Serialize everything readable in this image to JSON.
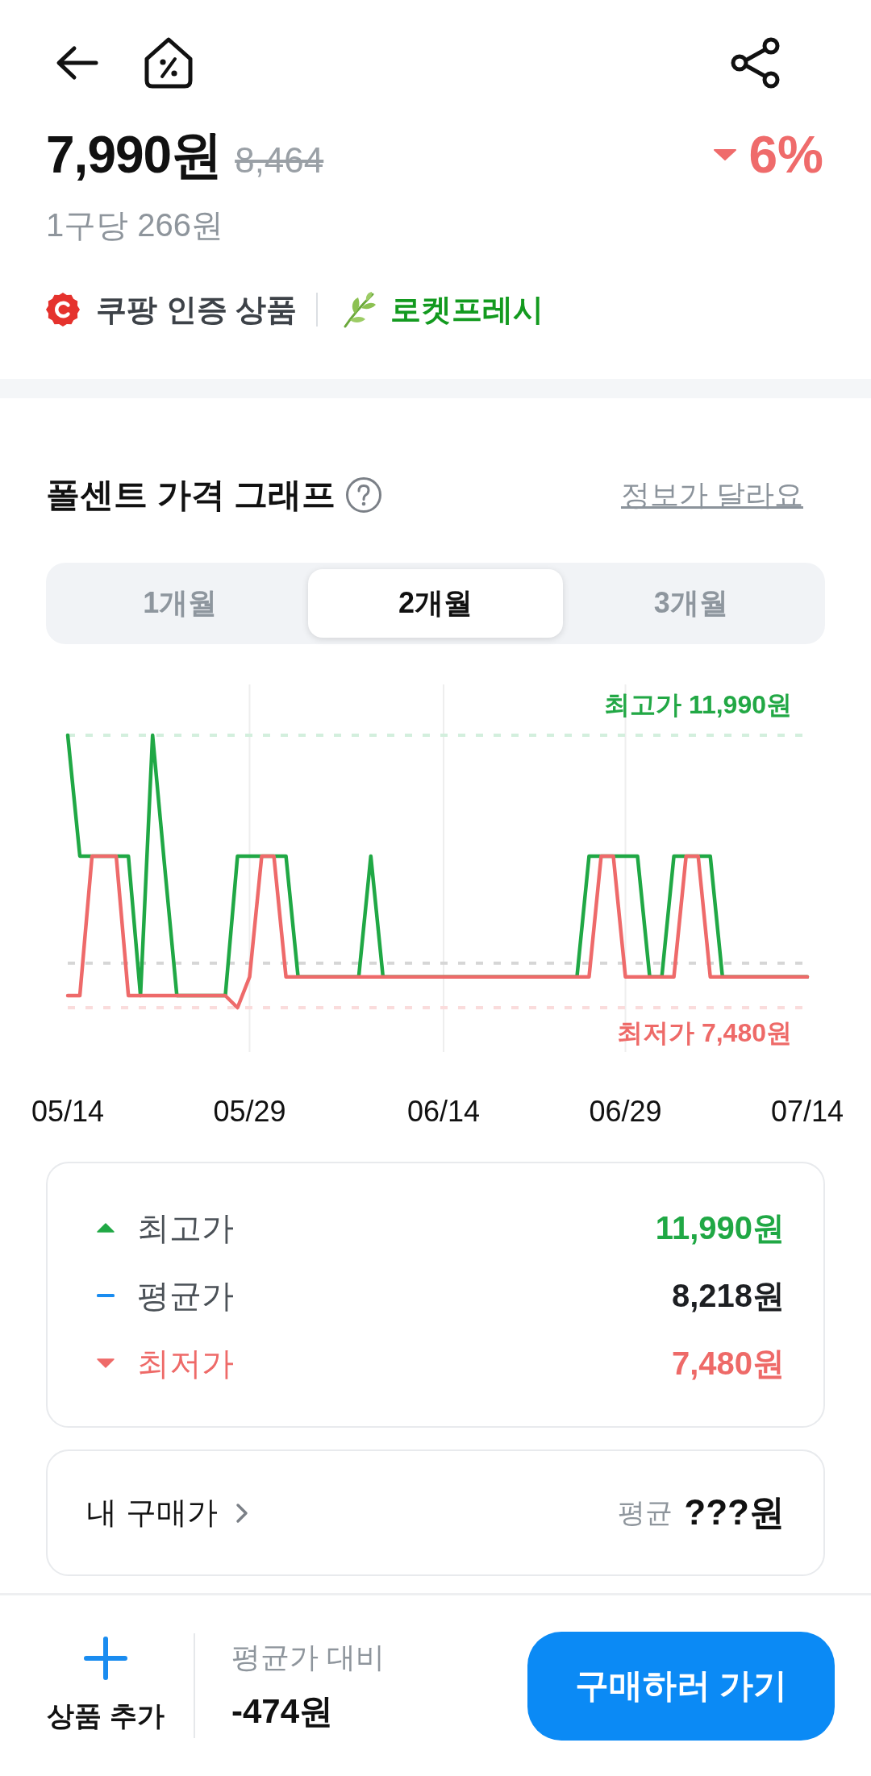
{
  "header": {
    "price": "7,990원",
    "original_price": "8,464",
    "discount": "6%",
    "unit_price": "1구당 266원"
  },
  "badges": [
    {
      "kind": "certified",
      "label": "쿠팡 인증 상품"
    },
    {
      "kind": "fresh",
      "label": "로켓프레시"
    }
  ],
  "price_graph": {
    "title": "폴센트 가격 그래프",
    "report_link": "정보가 달라요",
    "periods": [
      {
        "label": "1개월",
        "selected": false
      },
      {
        "label": "2개월",
        "selected": true
      },
      {
        "label": "3개월",
        "selected": false
      }
    ],
    "chart": {
      "max_label": "최고가 11,990원",
      "min_label": "최저가 7,480원",
      "date_labels": [
        "05/14",
        "05/29",
        "06/14",
        "06/29",
        "07/14"
      ]
    }
  },
  "price_summary": [
    {
      "kind": "high",
      "label": "최고가",
      "value": "11,990원"
    },
    {
      "kind": "average",
      "label": "평균가",
      "value": "8,218원"
    },
    {
      "kind": "low",
      "label": "최저가",
      "value": "7,480원"
    }
  ],
  "my_price": {
    "label": "내 구매가",
    "average_label": "평균",
    "value": "???원"
  },
  "bottom_bar": {
    "add_label": "상품 추가",
    "compare_label": "평균가 대비",
    "compare_value": "-474원",
    "buy_button": "구매하러 가기"
  }
}
